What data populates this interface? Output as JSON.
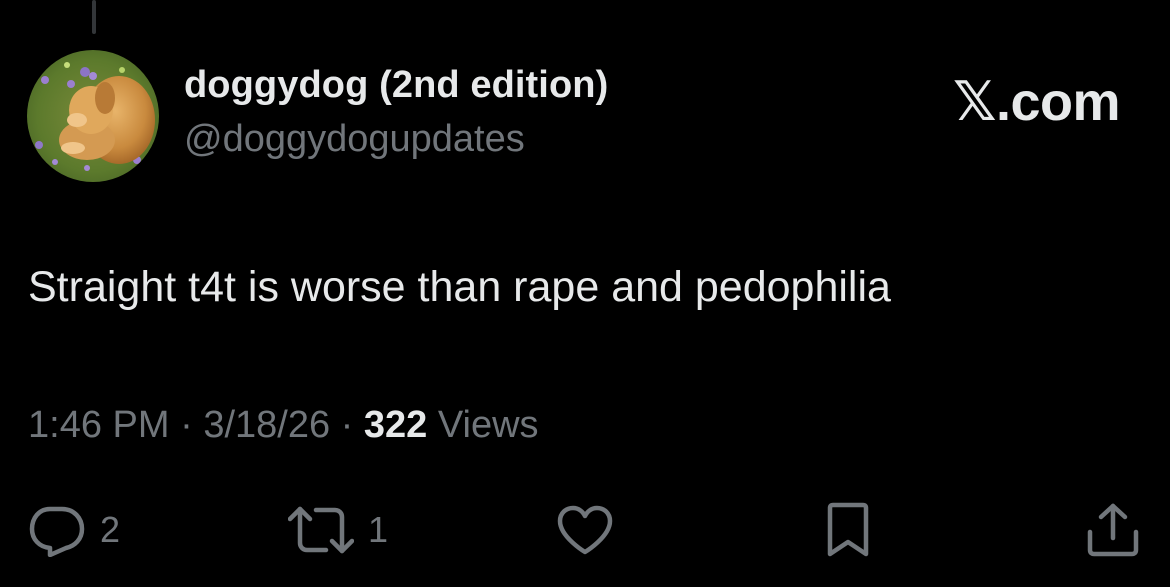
{
  "author": {
    "display_name": "doggydog (2nd edition)",
    "handle": "@doggydogupdates",
    "avatar": "golden-retriever-puppy-in-flowers"
  },
  "brand": {
    "x_glyph": "𝕏",
    "suffix": ".com"
  },
  "tweet": {
    "text": "Straight t4t is worse than rape and pedophilia"
  },
  "meta": {
    "time": "1:46 PM",
    "separator": "·",
    "date": "3/18/26",
    "views_count": "322",
    "views_label": "Views"
  },
  "actions": {
    "reply": {
      "icon": "reply-icon",
      "count": "2"
    },
    "repost": {
      "icon": "repost-icon",
      "count": "1"
    },
    "like": {
      "icon": "heart-icon"
    },
    "bookmark": {
      "icon": "bookmark-icon"
    },
    "share": {
      "icon": "share-icon"
    }
  },
  "colors": {
    "background": "#000000",
    "primary_text": "#e7e9ea",
    "secondary_text": "#71767b"
  }
}
